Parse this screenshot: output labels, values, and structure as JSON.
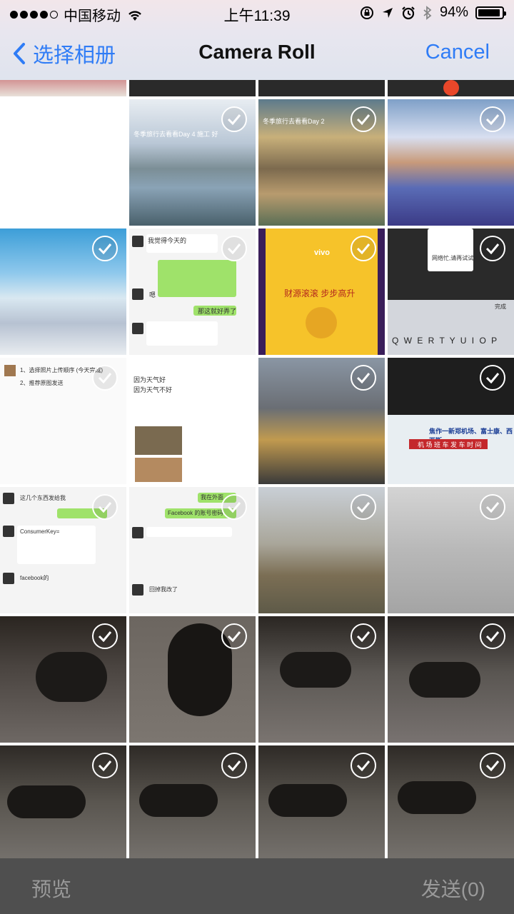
{
  "status_bar": {
    "carrier": "中国移动",
    "time": "上午11:39",
    "battery": "94%",
    "battery_level": 0.94
  },
  "nav": {
    "back_label": "选择相册",
    "title": "Camera Roll",
    "cancel_label": "Cancel"
  },
  "bottom": {
    "preview_label": "预览",
    "send_label": "发送(0)"
  },
  "tile_texts": {
    "t4_0": "冬季旅行去看看Day 4 施工 好",
    "t5_0": "冬季旅行去看看Day 2",
    "t10_0": "我觉得今天的",
    "t10_1": "嗯",
    "t10_2": "那这就好弄了",
    "t11_0": "财源滚滚 步步高升",
    "t11_1": "vivo",
    "t12_0": "网络忙,请再试试",
    "t12_1": "完成",
    "t12_keys": "Q W E R T Y U I O P",
    "t13_0": "1、选择照片上传顺序 (今天完成)",
    "t13_1": "2、推荐原图发送",
    "t14_0": "因为天气好",
    "t14_1": "因为天气不好",
    "t16_0": "焦作一新郑机场、富士康、西亚斯",
    "t16_1": "机 场 班 车 发 车 时 间",
    "t17_0": "这几个东西发给我",
    "t17_1": "ConsumerKey=",
    "t17_2": "facebook的",
    "t18_0": "我在外面",
    "t18_1": "Facebook 的账号密码",
    "t18_2": "回掉我改了"
  }
}
